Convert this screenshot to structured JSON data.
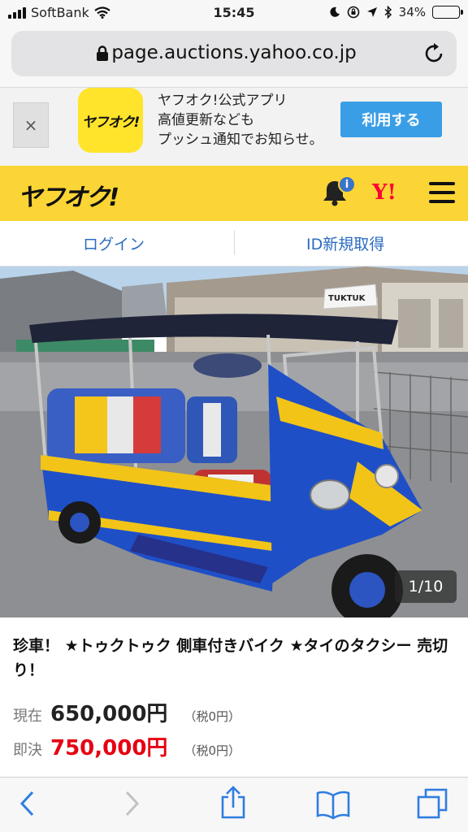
{
  "status_bar": {
    "carrier": "SoftBank",
    "time": "15:45",
    "battery_percent": "34%",
    "battery_level": 0.34
  },
  "address_bar": {
    "url": "page.auctions.yahoo.co.jp"
  },
  "app_banner": {
    "close_label": "×",
    "icon_text": "ヤフオク!",
    "lines": [
      "ヤフオク!公式アプリ",
      "高値更新なども",
      "プッシュ通知でお知らせ。"
    ],
    "button_label": "利用する"
  },
  "site_header": {
    "logo_text": "ヤフオク!",
    "notification_badge": "i",
    "yahoo_mark": "Y!",
    "brand_color": "#fbd535"
  },
  "account_links": {
    "login": "ログイン",
    "register": "ID新規取得"
  },
  "listing": {
    "photo_counter": "1/10",
    "title": "珍車！ ★トゥクトゥク 側車付きバイク ★タイのタクシー 売切り！",
    "current_price_label": "現在",
    "current_price": "650,000円",
    "current_tax": "（税0円）",
    "buyout_label": "即決",
    "buyout_price": "750,000円",
    "buyout_tax": "（税0円）",
    "buyout_color": "#e60012",
    "roof_sign": "TUKTUK"
  },
  "toolbar": {
    "icons": [
      "back-icon",
      "forward-icon",
      "share-icon",
      "bookmarks-icon",
      "tabs-icon"
    ]
  }
}
